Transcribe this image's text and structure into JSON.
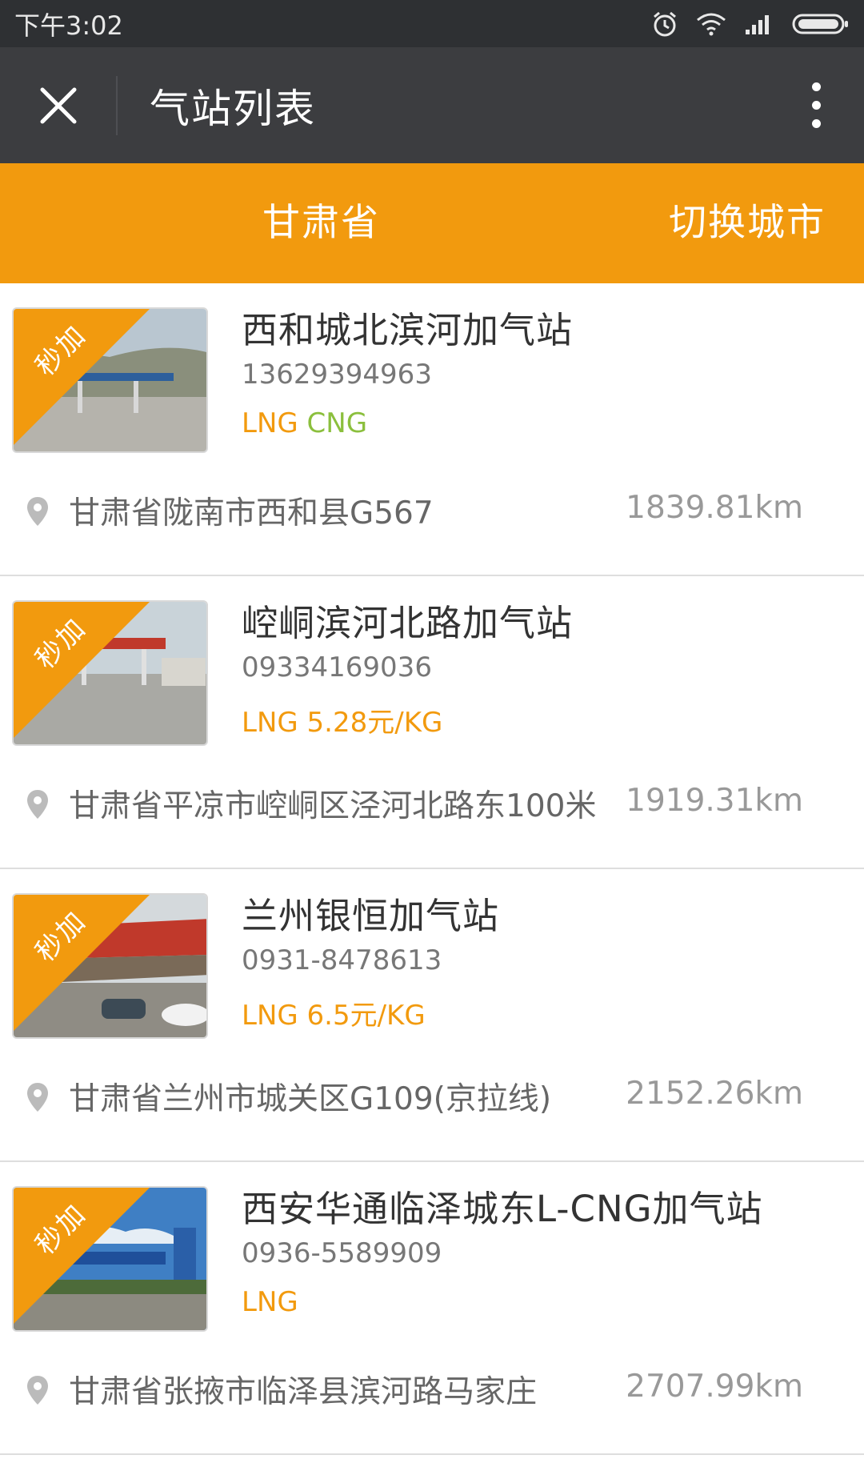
{
  "status_bar": {
    "time": "下午3:02"
  },
  "header": {
    "title": "气站列表"
  },
  "city_bar": {
    "province": "甘肃省",
    "switch_label": "切换城市"
  },
  "badge_label": "秒加",
  "stations": [
    {
      "name": "西和城北滨河加气站",
      "phone": "13629394963",
      "fuel_lng": "LNG",
      "fuel_extra": "CNG",
      "address": "甘肃省陇南市西和县G567",
      "distance": "1839.81km"
    },
    {
      "name": "崆峒滨河北路加气站",
      "phone": "09334169036",
      "fuel_lng": "LNG 5.28元/KG",
      "fuel_extra": "",
      "address": "甘肃省平凉市崆峒区泾河北路东100米",
      "distance": "1919.31km"
    },
    {
      "name": "兰州银恒加气站",
      "phone": "0931-8478613",
      "fuel_lng": "LNG 6.5元/KG",
      "fuel_extra": "",
      "address": "甘肃省兰州市城关区G109(京拉线)",
      "distance": "2152.26km"
    },
    {
      "name": "西安华通临泽城东L-CNG加气站",
      "phone": "0936-5589909",
      "fuel_lng": "LNG",
      "fuel_extra": "",
      "address": "甘肃省张掖市临泽县滨河路马家庄",
      "distance": "2707.99km"
    }
  ],
  "colors": {
    "accent": "#f29a0e",
    "cng": "#8bbf3d",
    "title_bar": "#3c3d40",
    "status_bar": "#2e3033"
  }
}
